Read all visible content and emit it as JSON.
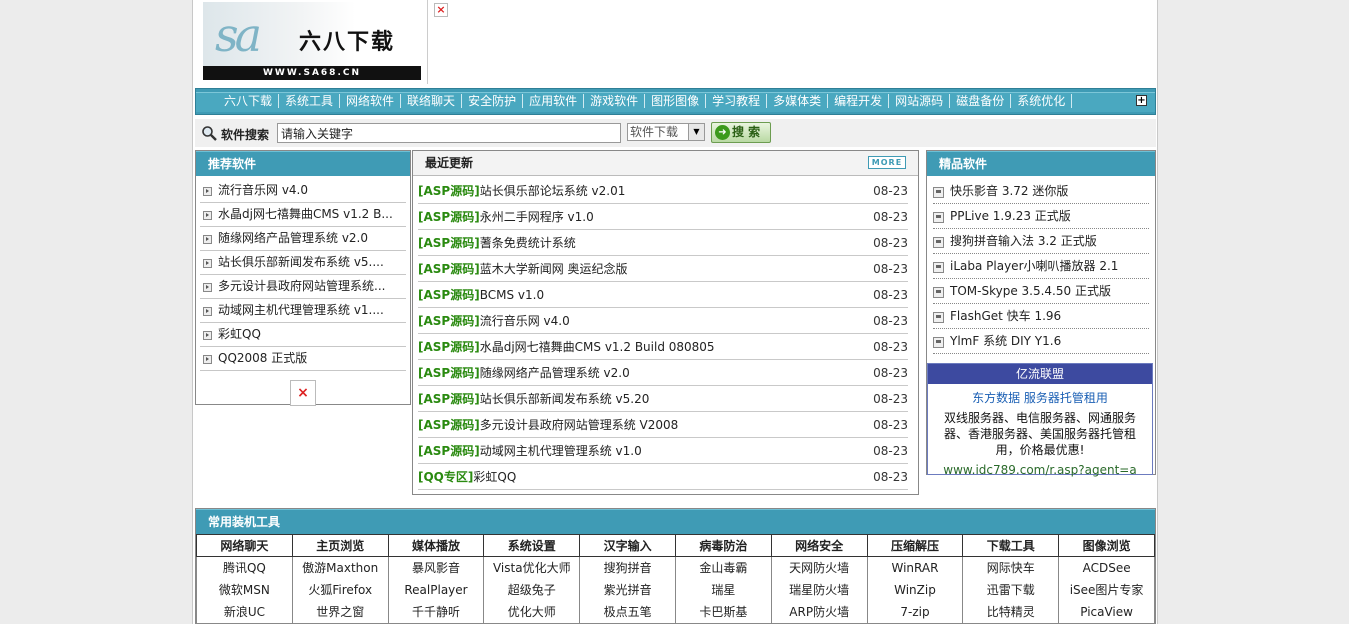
{
  "logo": {
    "mark": "sa",
    "name": "六八下载",
    "url": "WWW.SA68.CN"
  },
  "nav": {
    "items": [
      "六八下载",
      "系统工具",
      "网络软件",
      "联络聊天",
      "安全防护",
      "应用软件",
      "游戏软件",
      "图形图像",
      "学习教程",
      "多媒体类",
      "编程开发",
      "网站源码",
      "磁盘备份",
      "系统优化"
    ],
    "expand": "+"
  },
  "search": {
    "label": "软件搜索",
    "placeholder": "请输入关键字",
    "value": "请输入关键字",
    "category": "软件下载",
    "button": "搜 索"
  },
  "recommended": {
    "title": "推荐软件",
    "items": [
      "流行音乐网 v4.0",
      "水晶dj网七禧舞曲CMS v1.2 B...",
      "随缘网络产品管理系统 v2.0",
      "站长俱乐部新闻发布系统 v5....",
      "多元设计县政府网站管理系统...",
      "动域网主机代理管理系统 v1....",
      "彩虹QQ",
      "QQ2008 正式版"
    ]
  },
  "latest": {
    "title": "最近更新",
    "more": "MORE",
    "items": [
      {
        "cat": "ASP源码",
        "name": "站长俱乐部论坛系统 v2.01",
        "date": "08-23"
      },
      {
        "cat": "ASP源码",
        "name": "永州二手网程序 v1.0",
        "date": "08-23"
      },
      {
        "cat": "ASP源码",
        "name": "蓍条免费统计系统",
        "date": "08-23"
      },
      {
        "cat": "ASP源码",
        "name": "蓝木大学新闻网 奥运纪念版",
        "date": "08-23"
      },
      {
        "cat": "ASP源码",
        "name": "BCMS v1.0",
        "date": "08-23"
      },
      {
        "cat": "ASP源码",
        "name": "流行音乐网 v4.0",
        "date": "08-23"
      },
      {
        "cat": "ASP源码",
        "name": "水晶dj网七禧舞曲CMS v1.2 Build 080805",
        "date": "08-23"
      },
      {
        "cat": "ASP源码",
        "name": "随缘网络产品管理系统 v2.0",
        "date": "08-23"
      },
      {
        "cat": "ASP源码",
        "name": "站长俱乐部新闻发布系统 v5.20",
        "date": "08-23"
      },
      {
        "cat": "ASP源码",
        "name": "多元设计县政府网站管理系统 V2008",
        "date": "08-23"
      },
      {
        "cat": "ASP源码",
        "name": "动域网主机代理管理系统 v1.0",
        "date": "08-23"
      },
      {
        "cat": "QQ专区",
        "name": "彩虹QQ",
        "date": "08-23"
      }
    ]
  },
  "featured": {
    "title": "精品软件",
    "items": [
      "快乐影音 3.72 迷你版",
      "PPLive 1.9.23 正式版",
      "搜狗拼音输入法 3.2 正式版",
      "iLaba Player小喇叭播放器 2.1",
      "TOM-Skype 3.5.4.50 正式版",
      "FlashGet 快车 1.96",
      "YlmF 系统 DIY Y1.6"
    ]
  },
  "ad": {
    "head": "亿流联盟",
    "link": "东方数据 服务器托管租用",
    "text": "双线服务器、电信服务器、网通服务器、香港服务器、美国服务器托管租用，价格最优惠!",
    "url": "www.idc789.com/r.asp?agent=a"
  },
  "tools": {
    "title": "常用装机工具",
    "headers": [
      "网络聊天",
      "主页浏览",
      "媒体播放",
      "系统设置",
      "汉字输入",
      "病毒防治",
      "网络安全",
      "压缩解压",
      "下载工具",
      "图像浏览"
    ],
    "rows": [
      [
        "腾讯QQ",
        "傲游Maxthon",
        "暴风影音",
        "Vista优化大师",
        "搜狗拼音",
        "金山毒霸",
        "天网防火墙",
        "WinRAR",
        "网际快车",
        "ACDSee"
      ],
      [
        "微软MSN",
        "火狐Firefox",
        "RealPlayer",
        "超级兔子",
        "紫光拼音",
        "瑞星",
        "瑞星防火墙",
        "WinZip",
        "迅雷下载",
        "iSee图片专家"
      ],
      [
        "新浪UC",
        "世界之窗",
        "千千静听",
        "优化大师",
        "极点五笔",
        "卡巴斯基",
        "ARP防火墙",
        "7-zip",
        "比特精灵",
        "PicaView"
      ]
    ]
  }
}
